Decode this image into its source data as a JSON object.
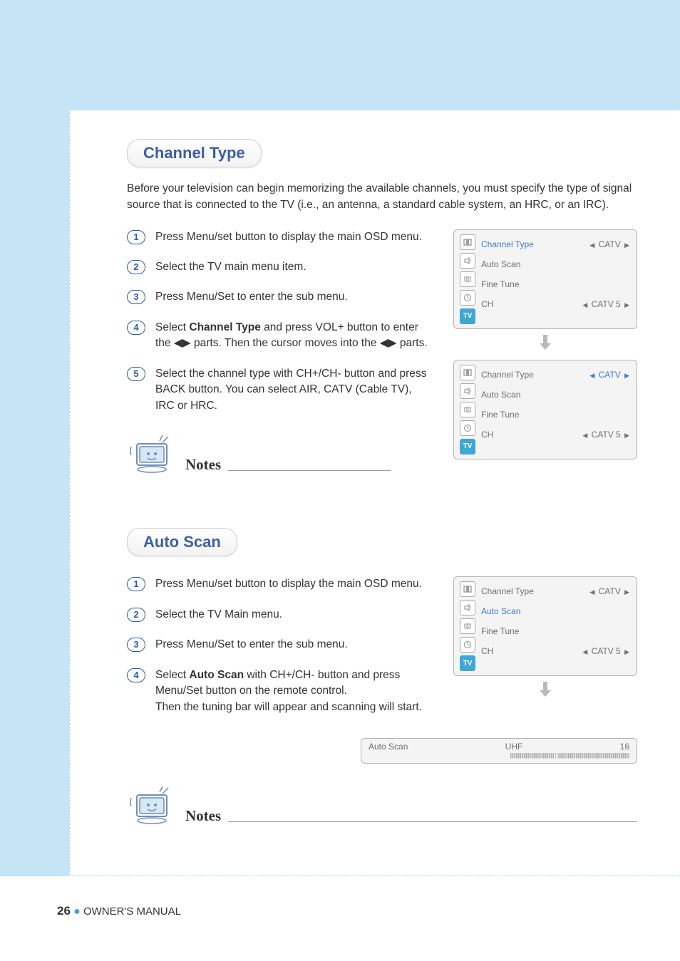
{
  "sections": {
    "channel_type": {
      "title": "Channel Type",
      "intro": "Before your television can begin memorizing the available channels, you must specify the type of signal source that is connected to the TV (i.e., an antenna, a standard cable system, an HRC, or an IRC).",
      "steps": {
        "s1": "Press Menu/set button to display the main OSD menu.",
        "s2": "Select the TV main menu item.",
        "s3": "Press Menu/Set to enter the sub menu.",
        "s4_pre": "Select ",
        "s4_bold": "Channel Type",
        "s4_post": " and press VOL+ button to enter the ◀▶ parts. Then the cursor moves into the ◀▶ parts.",
        "s5": "Select the channel type with CH+/CH- button and press BACK button. You can select AIR, CATV (Cable TV), IRC or HRC."
      }
    },
    "auto_scan": {
      "title": "Auto Scan",
      "steps": {
        "s1": "Press Menu/set button to display the main OSD menu.",
        "s2": "Select the TV Main menu.",
        "s3": "Press Menu/Set to enter the sub menu.",
        "s4_pre": "Select ",
        "s4_bold": "Auto Scan",
        "s4_post": " with CH+/CH- button and press Menu/Set button on the remote control.",
        "s4_line2": "Then the tuning bar will appear and  scanning will start."
      }
    }
  },
  "osd": {
    "rows": {
      "channel_type": "Channel Type",
      "auto_scan": "Auto Scan",
      "fine_tune": "Fine Tune",
      "ch": "CH"
    },
    "values": {
      "catv": "CATV",
      "catv5": "CATV 5"
    },
    "tv_icon": "TV"
  },
  "scan_bar": {
    "label": "Auto Scan",
    "band": "UHF",
    "num": "16"
  },
  "notes_label": "Notes",
  "nums": {
    "n1": "1",
    "n2": "2",
    "n3": "3",
    "n4": "4",
    "n5": "5"
  },
  "footer": {
    "page": "26",
    "label": "OWNER'S MANUAL"
  }
}
